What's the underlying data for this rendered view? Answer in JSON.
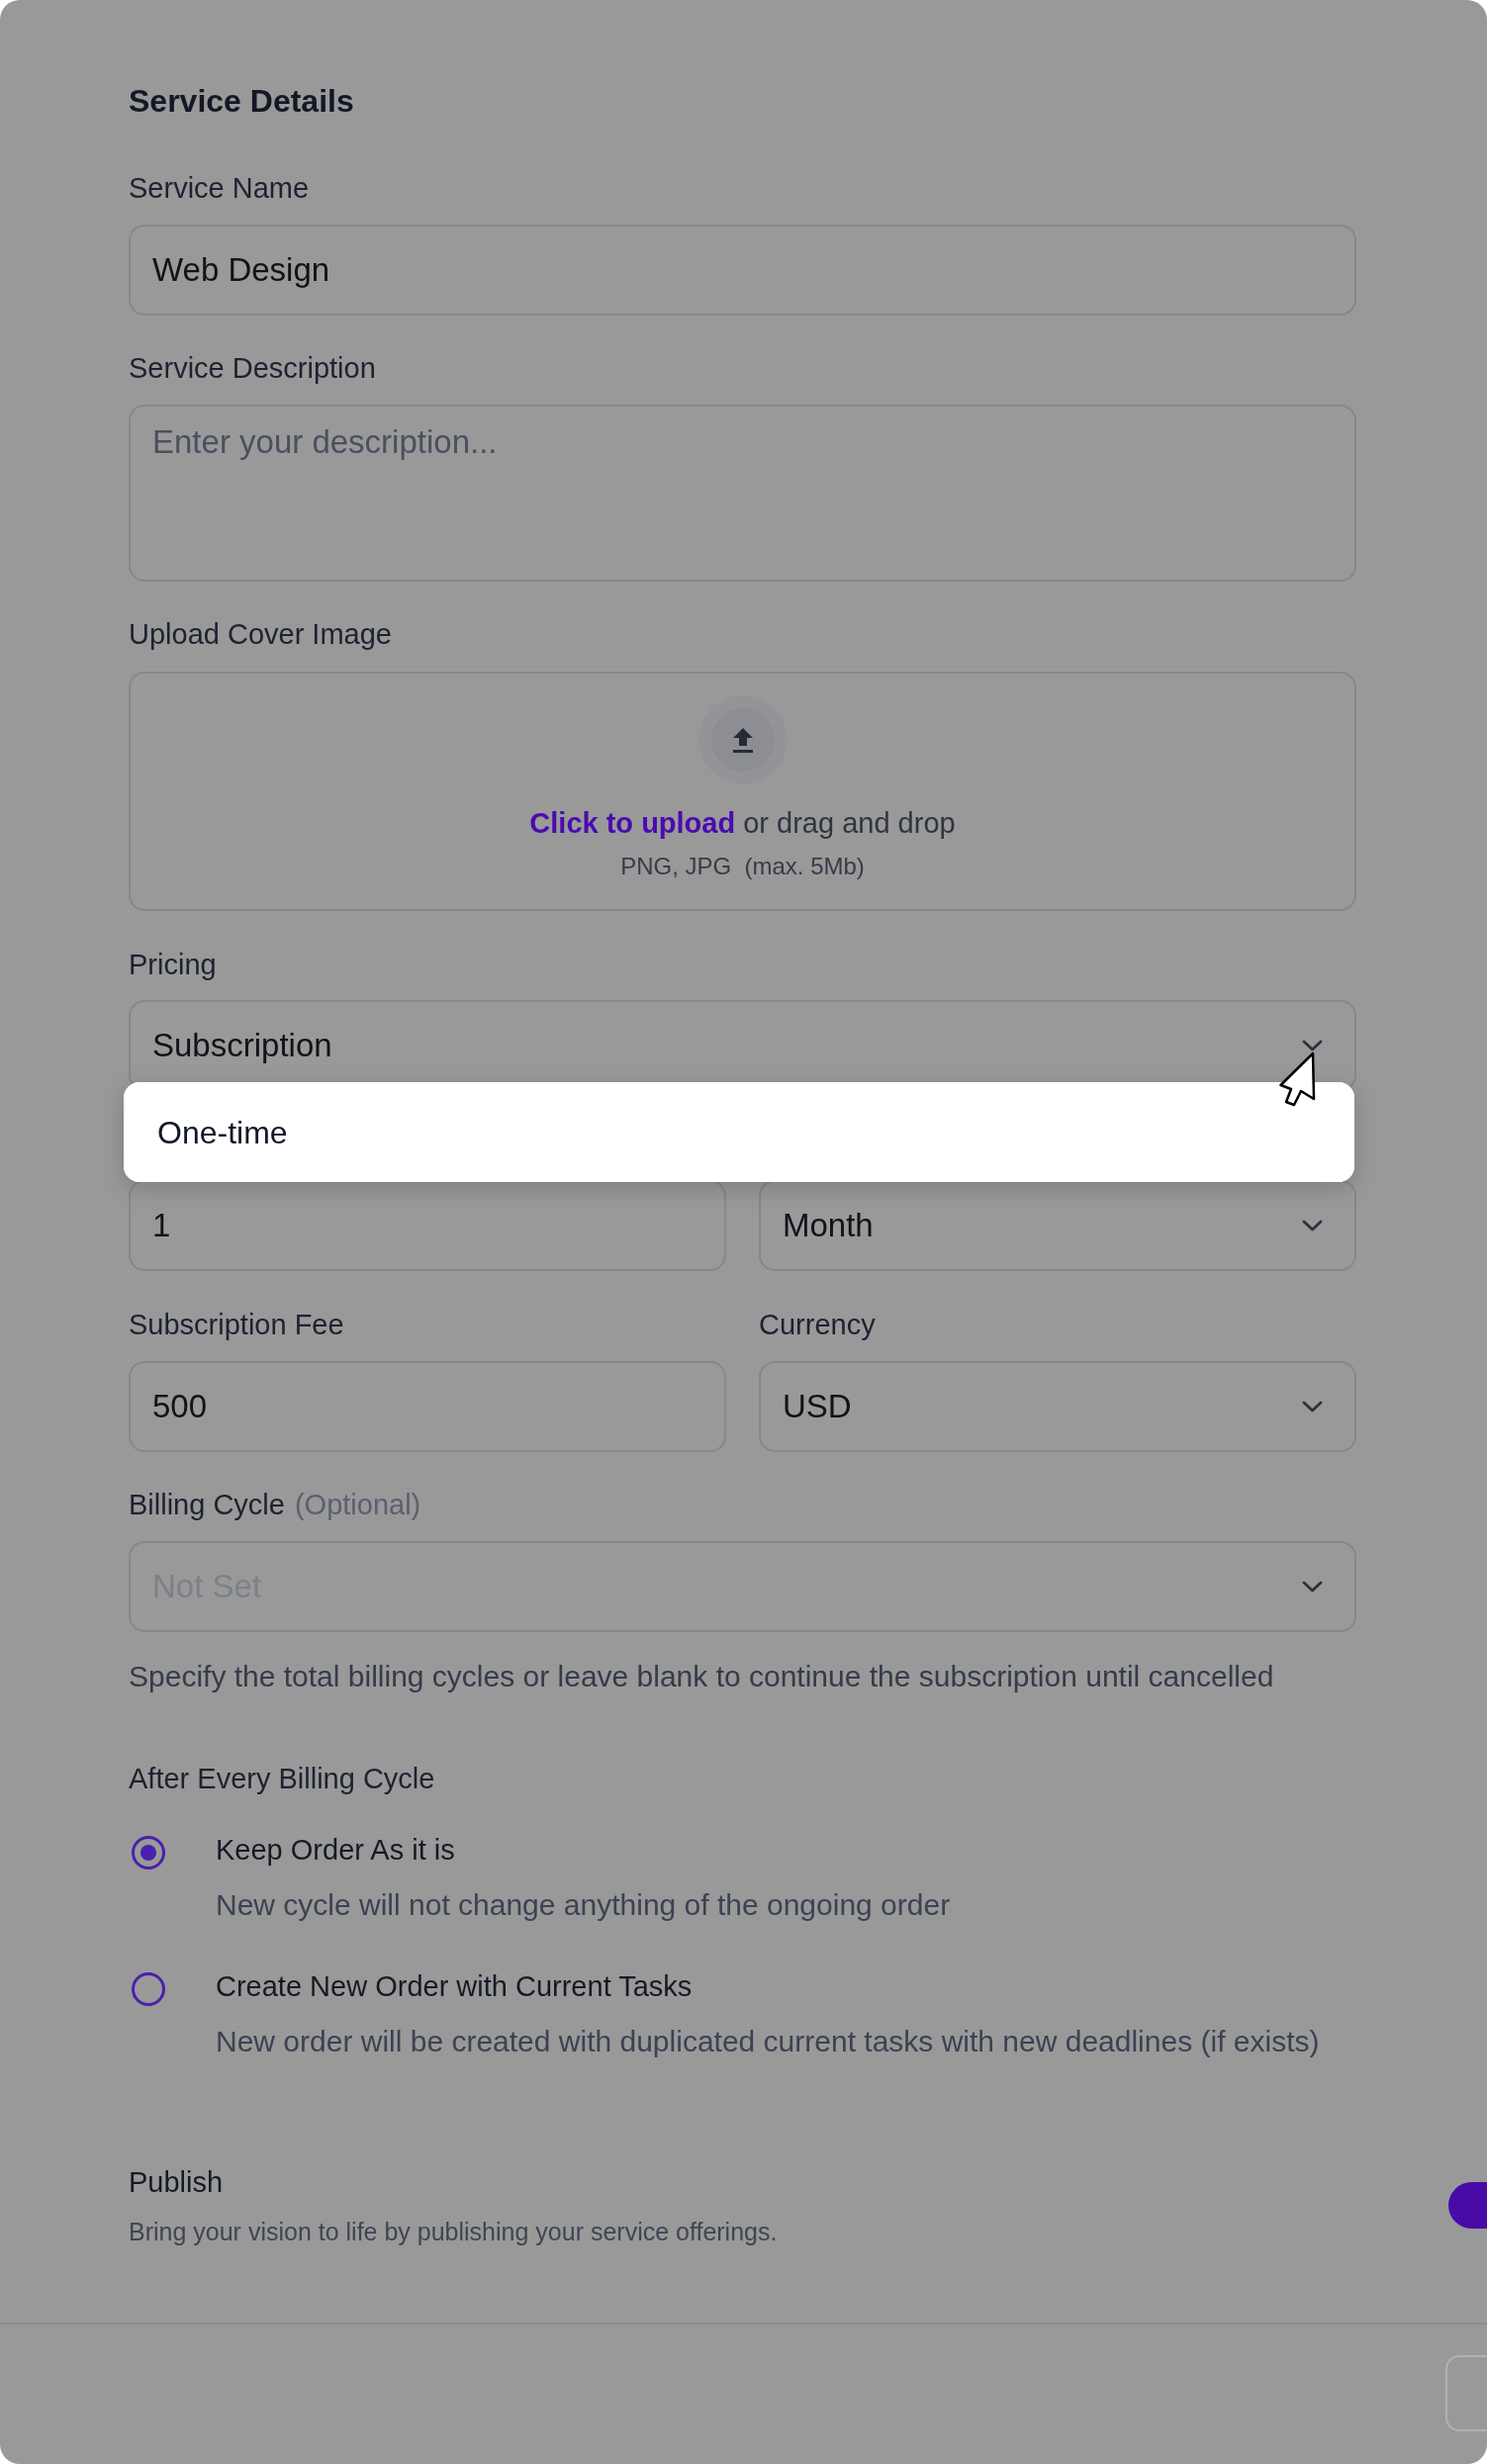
{
  "title": "Service Details",
  "service_name": {
    "label": "Service Name",
    "value": "Web Design"
  },
  "service_description": {
    "label": "Service Description",
    "placeholder": "Enter your description..."
  },
  "cover_image": {
    "label": "Upload Cover Image",
    "link": "Click to upload",
    "text": "or drag and drop",
    "hint": "PNG, JPG  (max. 5Mb)"
  },
  "pricing": {
    "label": "Pricing",
    "value": "Subscription",
    "expanded": true,
    "options": [
      {
        "label": "One-time",
        "selected": false
      }
    ]
  },
  "interval": {
    "count": "1",
    "unit": "Month"
  },
  "subscription_fee": {
    "label": "Subscription Fee",
    "value": "500"
  },
  "currency": {
    "label": "Currency",
    "value": "USD"
  },
  "billing_cycle": {
    "label": "Billing Cycle",
    "note": "(Optional)",
    "placeholder": "Not Set",
    "help": "Specify the total billing cycles or leave blank to continue the subscription until cancelled"
  },
  "after_every_billing_cycle": {
    "label": "After Every Billing Cycle",
    "options": [
      {
        "title": "Keep Order As it is",
        "description": "New cycle will not change anything of the ongoing order",
        "selected": true
      },
      {
        "title": "Create New Order with Current Tasks",
        "description": "New order will be created with duplicated current tasks with new deadlines (if exists)",
        "selected": false
      }
    ]
  },
  "publish": {
    "title": "Publish",
    "description": "Bring your vision to life by publishing your service offerings.",
    "on": true
  }
}
